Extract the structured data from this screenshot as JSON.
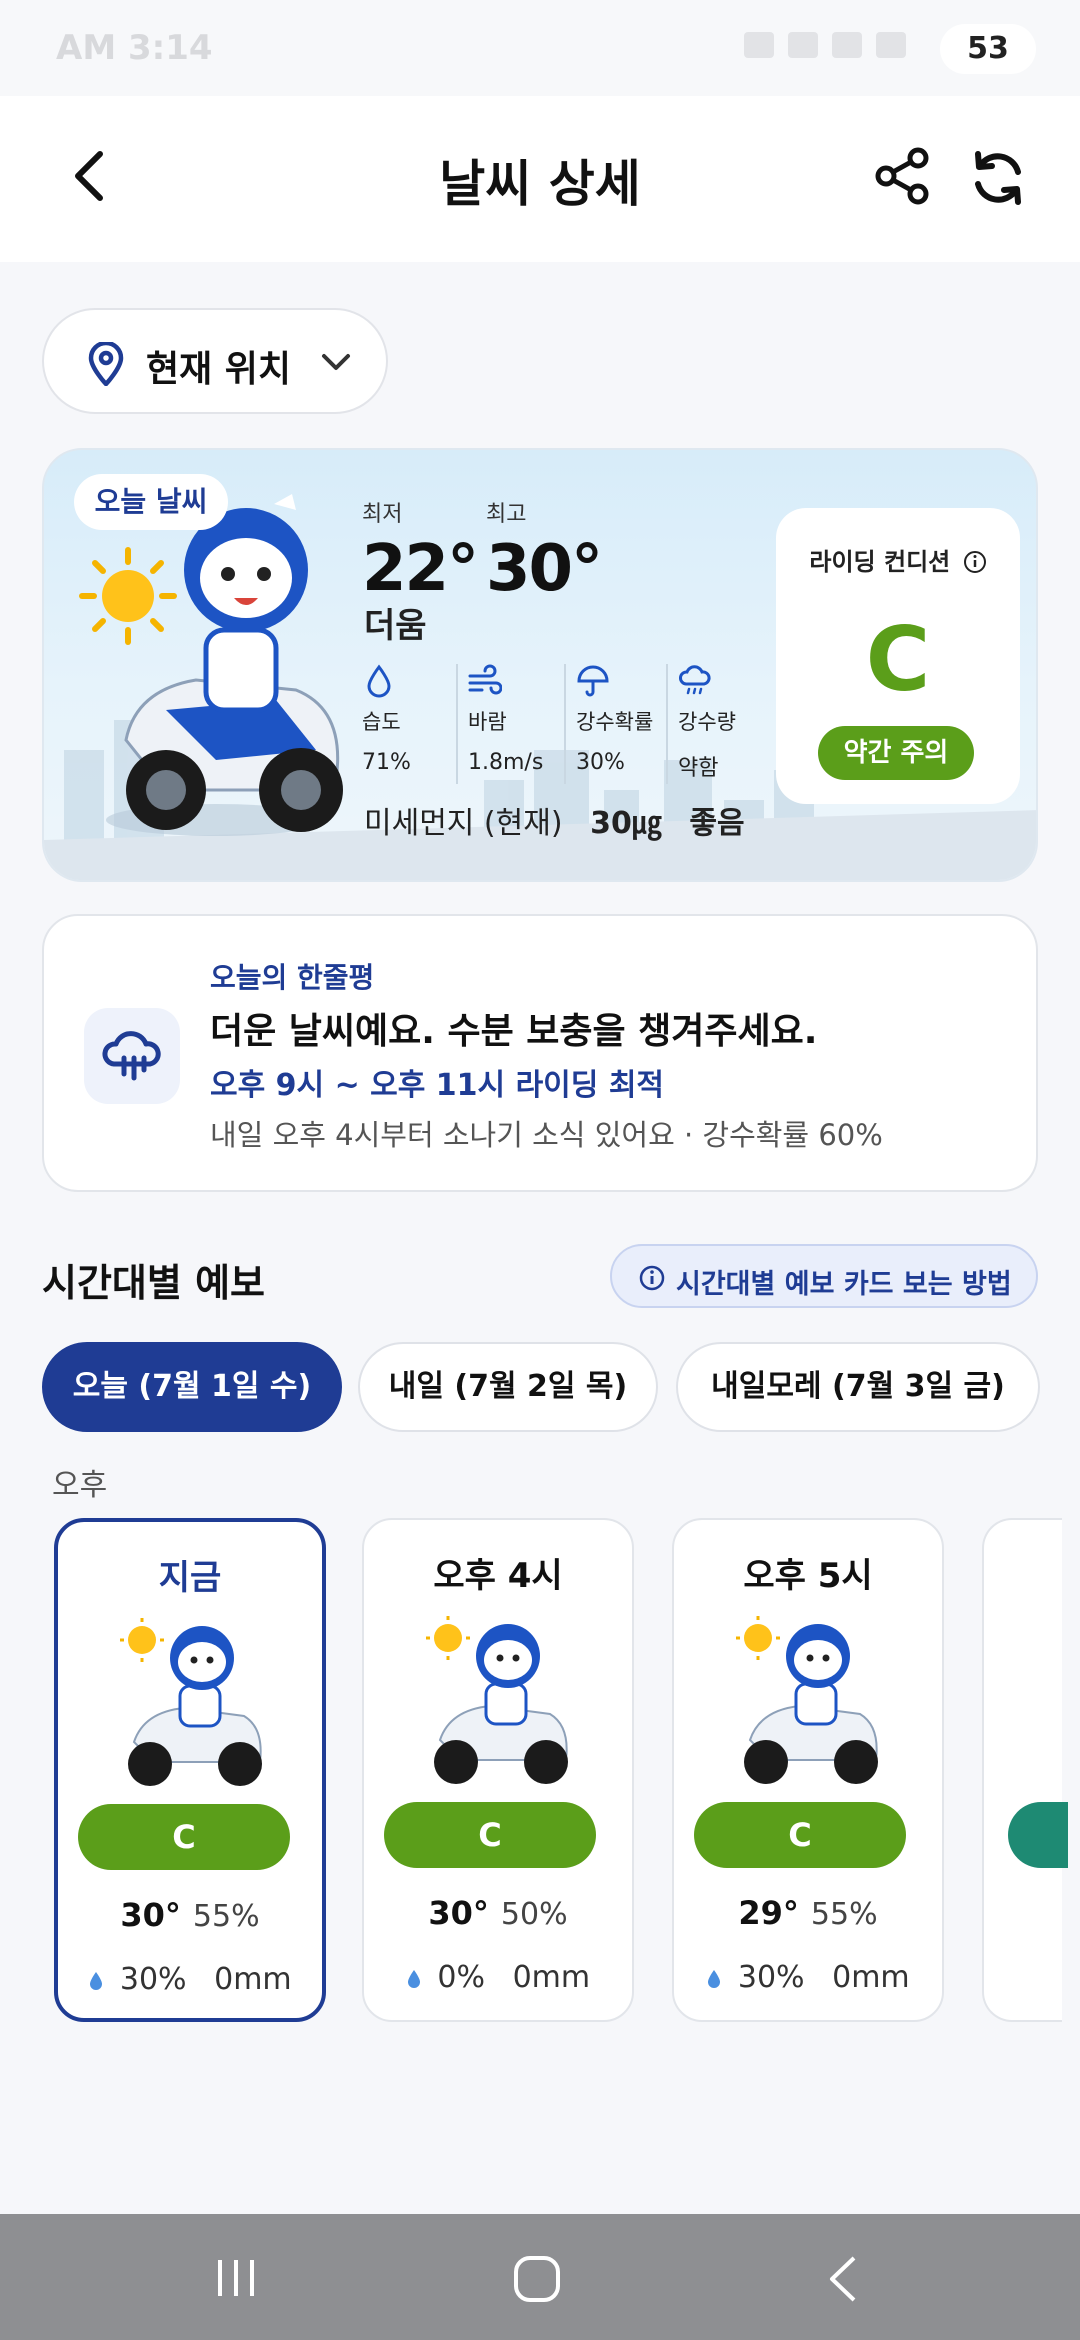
{
  "status_bar": {
    "time": "AM 3:14",
    "battery": "53"
  },
  "header": {
    "title": "날씨 상세"
  },
  "location": {
    "label": "현재 위치"
  },
  "today": {
    "badge": "오늘 날씨",
    "min_label": "최저",
    "min_temp": "22°",
    "max_label": "최고",
    "max_temp": "30°",
    "feel": "더움",
    "metrics": [
      {
        "name": "습도",
        "value": "71%",
        "icon": "humidity-icon"
      },
      {
        "name": "바람",
        "value": "1.8m/s",
        "icon": "wind-icon"
      },
      {
        "name": "강수확률",
        "value": "30%",
        "icon": "umbrella-icon"
      },
      {
        "name": "강수량",
        "value": "약함",
        "icon": "rain-cloud-icon"
      }
    ],
    "dust_label": "미세먼지 (현재)",
    "dust_value": "30㎍",
    "dust_grade": "좋음",
    "riding_label": "라이딩 컨디션",
    "riding_grade": "C",
    "riding_status": "약간 주의",
    "colors": {
      "grade_green": "#5b9e1a",
      "brand_navy": "#1f3c94"
    }
  },
  "summary": {
    "kicker": "오늘의 한줄평",
    "headline": "더운 날씨예요. 수분 보충을 챙겨주세요.",
    "best_time": "오후 9시 ~ 오후 11시 라이딩 최적",
    "note": "내일 오후 4시부터 소나기 소식 있어요 · 강수확률 60%"
  },
  "hourly": {
    "title": "시간대별 예보",
    "help": "시간대별 예보 카드 보는 방법",
    "tabs": [
      "오늘 (7월 1일 수)",
      "내일 (7월 2일 목)",
      "내일모레 (7월 3일 금)"
    ],
    "active_tab": 0,
    "period": "오후",
    "cards": [
      {
        "label": "지금",
        "grade": "C",
        "temp": "30°",
        "humidity": "55%",
        "rain_prob": "30%",
        "rain_amt": "0mm"
      },
      {
        "label": "오후 4시",
        "grade": "C",
        "temp": "30°",
        "humidity": "50%",
        "rain_prob": "0%",
        "rain_amt": "0mm"
      },
      {
        "label": "오후 5시",
        "grade": "C",
        "temp": "29°",
        "humidity": "55%",
        "rain_prob": "30%",
        "rain_amt": "0mm"
      }
    ]
  }
}
